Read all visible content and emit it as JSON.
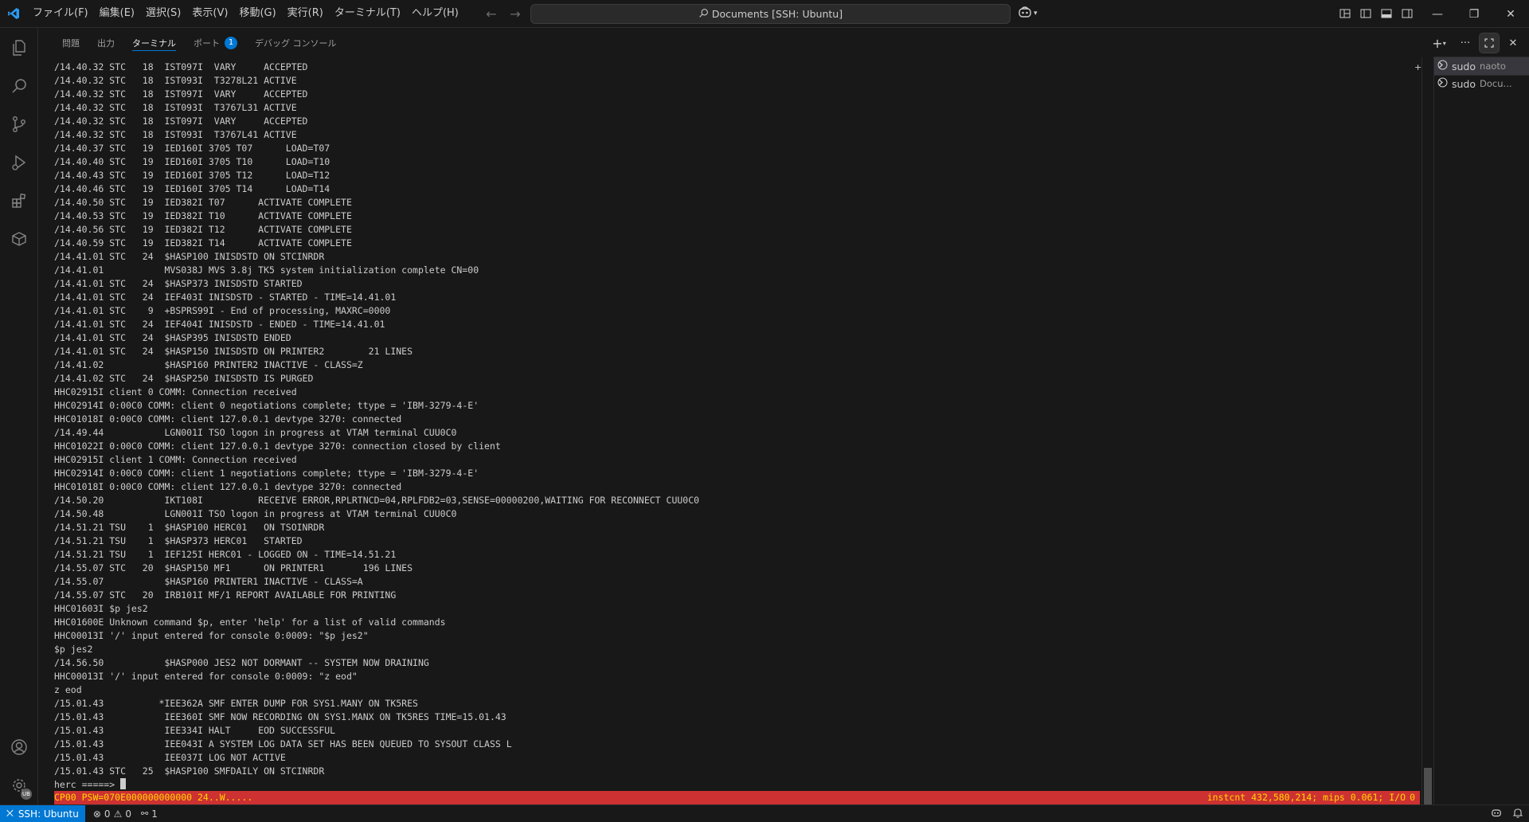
{
  "titlebar": {
    "menus": [
      "ファイル(F)",
      "編集(E)",
      "選択(S)",
      "表示(V)",
      "移動(G)",
      "実行(R)",
      "ターミナル(T)",
      "ヘルプ(H)"
    ],
    "search_text": "Documents [SSH: Ubuntu]"
  },
  "panel": {
    "tabs": [
      {
        "label": "問題",
        "active": false
      },
      {
        "label": "出力",
        "active": false
      },
      {
        "label": "ターミナル",
        "active": true
      },
      {
        "label": "ポート",
        "active": false,
        "badge": "1"
      },
      {
        "label": "デバッグ コンソール",
        "active": false
      }
    ]
  },
  "terminal": {
    "lines": [
      "/14.40.32 STC   18  IST097I  VARY     ACCEPTED",
      "/14.40.32 STC   18  IST093I  T3278L21 ACTIVE",
      "/14.40.32 STC   18  IST097I  VARY     ACCEPTED",
      "/14.40.32 STC   18  IST093I  T3767L31 ACTIVE",
      "/14.40.32 STC   18  IST097I  VARY     ACCEPTED",
      "/14.40.32 STC   18  IST093I  T3767L41 ACTIVE",
      "/14.40.37 STC   19  IED160I 3705 T07      LOAD=T07",
      "/14.40.40 STC   19  IED160I 3705 T10      LOAD=T10",
      "/14.40.43 STC   19  IED160I 3705 T12      LOAD=T12",
      "/14.40.46 STC   19  IED160I 3705 T14      LOAD=T14",
      "/14.40.50 STC   19  IED382I T07      ACTIVATE COMPLETE",
      "/14.40.53 STC   19  IED382I T10      ACTIVATE COMPLETE",
      "/14.40.56 STC   19  IED382I T12      ACTIVATE COMPLETE",
      "/14.40.59 STC   19  IED382I T14      ACTIVATE COMPLETE",
      "/14.41.01 STC   24  $HASP100 INISDSTD ON STCINRDR",
      "/14.41.01           MVS038J MVS 3.8j TK5 system initialization complete CN=00",
      "/14.41.01 STC   24  $HASP373 INISDSTD STARTED",
      "/14.41.01 STC   24  IEF403I INISDSTD - STARTED - TIME=14.41.01",
      "/14.41.01 STC    9  +BSPRS99I - End of processing, MAXRC=0000",
      "/14.41.01 STC   24  IEF404I INISDSTD - ENDED - TIME=14.41.01",
      "/14.41.01 STC   24  $HASP395 INISDSTD ENDED",
      "/14.41.01 STC   24  $HASP150 INISDSTD ON PRINTER2        21 LINES",
      "/14.41.02           $HASP160 PRINTER2 INACTIVE - CLASS=Z",
      "/14.41.02 STC   24  $HASP250 INISDSTD IS PURGED",
      "HHC02915I client 0 COMM: Connection received",
      "HHC02914I 0:00C0 COMM: client 0 negotiations complete; ttype = 'IBM-3279-4-E'",
      "HHC01018I 0:00C0 COMM: client 127.0.0.1 devtype 3270: connected",
      "/14.49.44           LGN001I TSO logon in progress at VTAM terminal CUU0C0",
      "HHC01022I 0:00C0 COMM: client 127.0.0.1 devtype 3270: connection closed by client",
      "HHC02915I client 1 COMM: Connection received",
      "HHC02914I 0:00C0 COMM: client 1 negotiations complete; ttype = 'IBM-3279-4-E'",
      "HHC01018I 0:00C0 COMM: client 127.0.0.1 devtype 3270: connected",
      "/14.50.20           IKT108I          RECEIVE ERROR,RPLRTNCD=04,RPLFDB2=03,SENSE=00000200,WAITING FOR RECONNECT CUU0C0",
      "/14.50.48           LGN001I TSO logon in progress at VTAM terminal CUU0C0",
      "/14.51.21 TSU    1  $HASP100 HERC01   ON TSOINRDR",
      "/14.51.21 TSU    1  $HASP373 HERC01   STARTED",
      "/14.51.21 TSU    1  IEF125I HERC01 - LOGGED ON - TIME=14.51.21",
      "/14.55.07 STC   20  $HASP150 MF1      ON PRINTER1       196 LINES",
      "/14.55.07           $HASP160 PRINTER1 INACTIVE - CLASS=A",
      "/14.55.07 STC   20  IRB101I MF/1 REPORT AVAILABLE FOR PRINTING",
      "HHC01603I $p jes2",
      "HHC01600E Unknown command $p, enter 'help' for a list of valid commands",
      "HHC00013I '/' input entered for console 0:0009: \"$p jes2\"",
      "$p jes2",
      "/14.56.50           $HASP000 JES2 NOT DORMANT -- SYSTEM NOW DRAINING",
      "HHC00013I '/' input entered for console 0:0009: \"z eod\"",
      "z eod",
      "/15.01.43          *IEE362A SMF ENTER DUMP FOR SYS1.MANY ON TK5RES",
      "/15.01.43           IEE360I SMF NOW RECORDING ON SYS1.MANX ON TK5RES TIME=15.01.43",
      "/15.01.43           IEE334I HALT     EOD SUCCESSFUL",
      "/15.01.43           IEE043I A SYSTEM LOG DATA SET HAS BEEN QUEUED TO SYSOUT CLASS L",
      "/15.01.43           IEE037I LOG NOT ACTIVE",
      "/15.01.43 STC   25  $HASP100 SMFDAILY ON STCINRDR"
    ],
    "prompt": "herc =====> ",
    "status_left": "CP00 PSW=070E000000000000 24..W.....",
    "status_right": "instcnt 432,580,214; mips 0.061; I/O",
    "status_right_num": "0"
  },
  "terminal_list": [
    {
      "name": "sudo",
      "sub": "naoto",
      "active": true
    },
    {
      "name": "sudo",
      "sub": "Docu...",
      "active": false
    }
  ],
  "statusbar": {
    "remote": "SSH: Ubuntu",
    "errors": "0",
    "warnings": "0",
    "ports": "1"
  },
  "colors": {
    "accent": "#0078d4",
    "terminal_status_bg": "#cd3131",
    "terminal_status_fg": "#ffd700"
  }
}
